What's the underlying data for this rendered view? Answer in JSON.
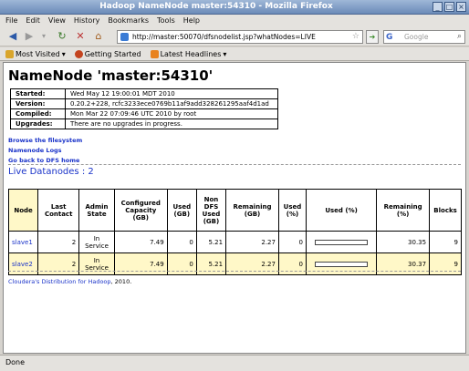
{
  "window": {
    "title": "Hadoop NameNode master:54310 - Mozilla Firefox"
  },
  "menu": [
    "File",
    "Edit",
    "View",
    "History",
    "Bookmarks",
    "Tools",
    "Help"
  ],
  "nav": {
    "url": "http://master:50070/dfsnodelist.jsp?whatNodes=LIVE",
    "search_placeholder": "Google"
  },
  "bookmarks": [
    "Most Visited",
    "Getting Started",
    "Latest Headlines"
  ],
  "page": {
    "heading": "NameNode 'master:54310'",
    "info": [
      {
        "key": "Started:",
        "value": "Wed May 12 19:00:01 MDT 2010"
      },
      {
        "key": "Version:",
        "value": "0.20.2+228, rcfc3233ece0769b11af9add328261295aaf4d1ad"
      },
      {
        "key": "Compiled:",
        "value": "Mon Mar 22 07:09:46 UTC 2010 by root"
      },
      {
        "key": "Upgrades:",
        "value": "There are no upgrades in progress."
      }
    ],
    "links": [
      "Browse the filesystem",
      "Namenode Logs",
      "Go back to DFS home"
    ],
    "live_title": "Live Datanodes : 2",
    "table": {
      "headers": [
        "Node",
        "Last Contact",
        "Admin State",
        "Configured Capacity (GB)",
        "Used (GB)",
        "Non DFS Used (GB)",
        "Remaining (GB)",
        "Used (%)",
        "Used (%)",
        "Remaining (%)",
        "Blocks"
      ],
      "rows": [
        {
          "node": "slave1",
          "last_contact": "2",
          "admin_state": "In Service",
          "capacity": "7.49",
          "used": "0",
          "non_dfs": "5.21",
          "remaining": "2.27",
          "used_pct": "0",
          "used_bar": 0,
          "remaining_pct": "30.35",
          "blocks": "9"
        },
        {
          "node": "slave2",
          "last_contact": "2",
          "admin_state": "In Service",
          "capacity": "7.49",
          "used": "0",
          "non_dfs": "5.21",
          "remaining": "2.27",
          "used_pct": "0",
          "used_bar": 0,
          "remaining_pct": "30.37",
          "blocks": "9"
        }
      ]
    },
    "footer_link": "Cloudera's Distribution for Hadoop",
    "footer_suffix": ", 2010."
  },
  "status": "Done"
}
